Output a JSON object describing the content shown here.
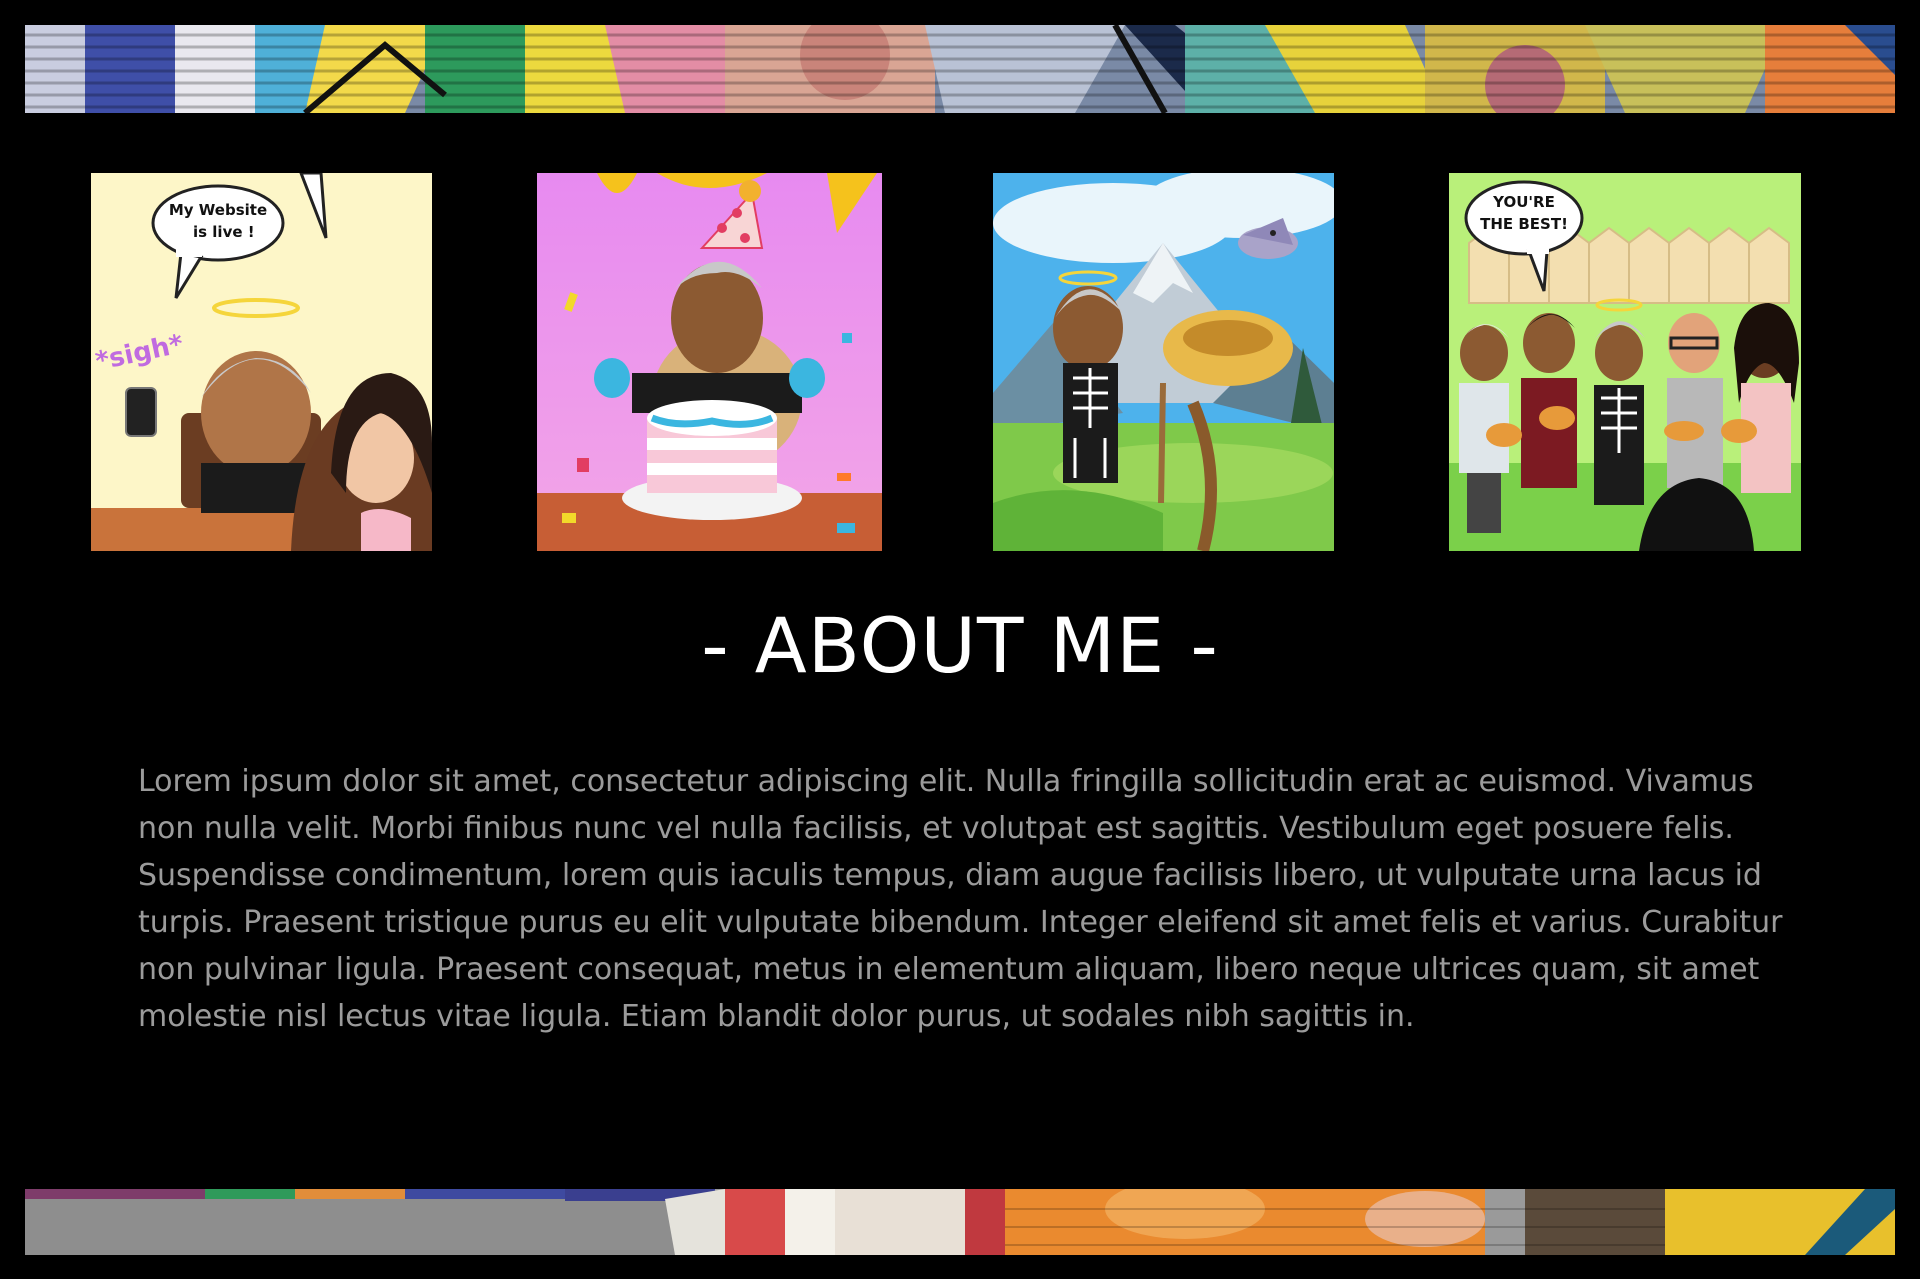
{
  "colors": {
    "background": "#000000",
    "heading": "#ffffff",
    "body_text": "#9b9b9b"
  },
  "banners": {
    "top": {
      "icon": "mural-graffiti-banner"
    },
    "bottom": {
      "icon": "mural-graffiti-banner"
    }
  },
  "gallery": [
    {
      "icon": "bitmoji-website-live-image",
      "bubble_lines": [
        "My Website",
        "is live !"
      ],
      "caption_text": "*sigh*"
    },
    {
      "icon": "bitmoji-birthday-cake-image"
    },
    {
      "icon": "bitmoji-mountain-nest-image"
    },
    {
      "icon": "bitmoji-friends-group-image",
      "bubble_lines": [
        "YOU'RE",
        "THE BEST!"
      ]
    }
  ],
  "about": {
    "heading": "- ABOUT ME -",
    "body": "Lorem ipsum dolor sit amet, consectetur adipiscing elit. Nulla fringilla sollicitudin erat ac euismod. Vivamus non nulla velit. Morbi finibus nunc vel nulla facilisis, et volutpat est sagittis. Vestibulum eget posuere felis. Suspendisse condimentum, lorem quis iaculis tempus, diam augue facilisis libero, ut vulputate urna lacus id turpis. Praesent tristique purus eu elit vulputate bibendum. Integer eleifend sit amet felis et varius. Curabitur non pulvinar ligula. Praesent consequat, metus in elementum aliquam, libero neque ultrices quam, sit amet molestie nisl lectus vitae ligula. Etiam blandit dolor purus, ut sodales nibh sagittis in."
  }
}
